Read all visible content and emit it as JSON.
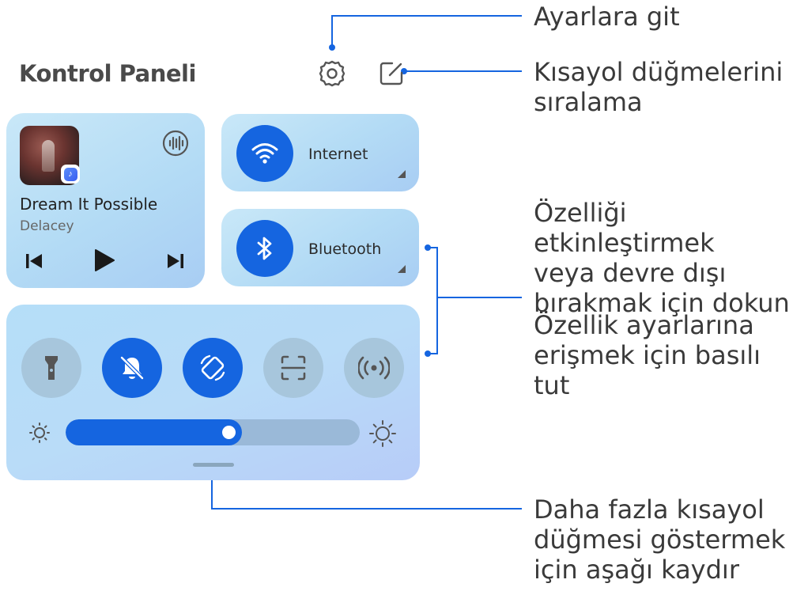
{
  "panel": {
    "title": "Kontrol Paneli"
  },
  "header": {
    "settings_icon": "gear-icon",
    "edit_icon": "edit-icon"
  },
  "music": {
    "song": "Dream It Possible",
    "artist": "Delacey",
    "album_badge_icon": "music-note-icon",
    "controls": [
      "previous-icon",
      "play-icon",
      "next-icon"
    ],
    "audio_icon": "audio-output-icon"
  },
  "tiles": [
    {
      "label": "Internet",
      "icon": "wifi-icon"
    },
    {
      "label": "Bluetooth",
      "icon": "bluetooth-icon"
    }
  ],
  "quick_buttons": [
    {
      "icon": "flashlight-icon",
      "active": false
    },
    {
      "icon": "bell-off-icon",
      "active": true
    },
    {
      "icon": "auto-rotate-icon",
      "active": true
    },
    {
      "icon": "scan-icon",
      "active": false
    },
    {
      "icon": "hotspot-icon",
      "active": false
    }
  ],
  "brightness": {
    "level_percent": 60
  },
  "annotations": {
    "settings": "Ayarlara git",
    "sort_line1": "Kısayol düğmelerini",
    "sort_line2": "sıralama",
    "tap_line1": "Özelliği etkinleştirmek",
    "tap_line2": "veya devre dışı",
    "tap_line3": "bırakmak için dokun",
    "hold_line1": "Özellik ayarlarına",
    "hold_line2": "erişmek için basılı tut",
    "swipe_line1": "Daha fazla kısayol",
    "swipe_line2": "düğmesi göstermek",
    "swipe_line3": "için aşağı kaydır"
  },
  "colors": {
    "accent": "#1565e0",
    "annotation_line": "#1565e0",
    "card_bg": "#b9dcf6"
  }
}
